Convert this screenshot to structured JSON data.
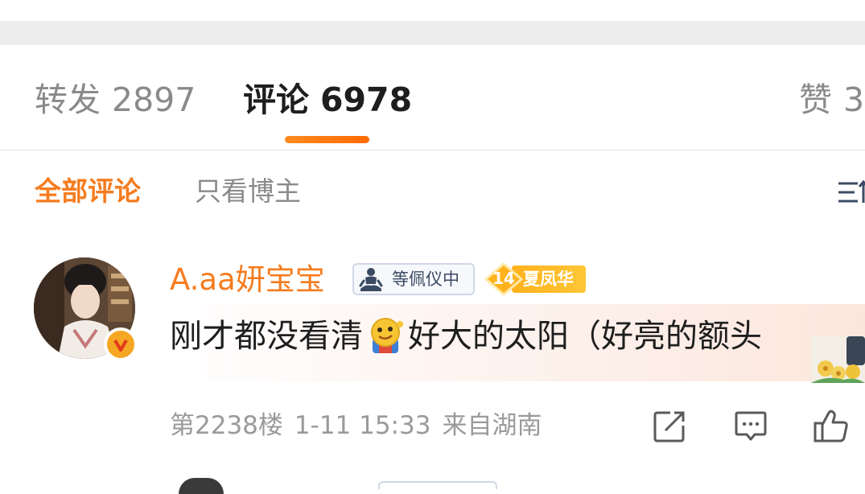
{
  "tabs": {
    "repost": {
      "label": "转发",
      "count": "2897"
    },
    "comments": {
      "label": "评论",
      "count": "6978"
    },
    "likes": {
      "label": "赞",
      "count": "3"
    }
  },
  "filters": {
    "all": "全部评论",
    "owner_only": "只看博主"
  },
  "comment": {
    "username": "A.aa妍宝宝",
    "fan_badge": "等佩仪中",
    "level_number": "14",
    "level_name": "夏凤华",
    "text_before_emoji": "刚才都没看清",
    "text_after_emoji": "好大的太阳（好亮的额头",
    "floor": "第2238楼",
    "time": "1-11 15:33",
    "location": "来自湖南"
  },
  "icons": {
    "sort": "sort-icon",
    "verified": "verified-badge-icon",
    "share": "share-icon",
    "reply": "reply-icon",
    "like": "like-icon"
  },
  "colors": {
    "accent": "#f57c1f",
    "tab_underline": "#ff7a12",
    "muted_text": "#8a8a8a",
    "primary_text": "#1e1e1e",
    "level_badge": "#ffb21c"
  }
}
